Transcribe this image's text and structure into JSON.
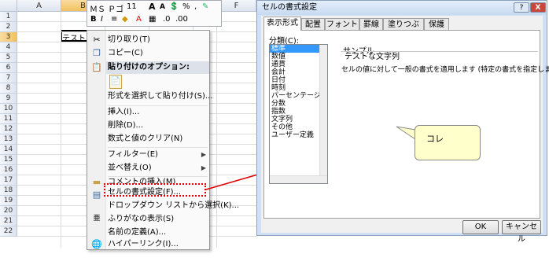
{
  "sheet": {
    "columns": [
      "A",
      "B",
      "C",
      "D",
      "E",
      "F"
    ],
    "rows": [
      "1",
      "2",
      "3",
      "4",
      "5",
      "6",
      "7",
      "8",
      "9",
      "10",
      "11",
      "12",
      "13",
      "14",
      "15",
      "16",
      "17",
      "18",
      "19",
      "20",
      "21",
      "22"
    ],
    "cell_b3": "テストな文字列"
  },
  "mini_toolbar": {
    "font": "ＭＳ Ｐゴ",
    "size": "11",
    "grow": "A",
    "shrink": "A",
    "currency": "",
    "percent": "%",
    "comma": ",",
    "bold": "B",
    "italic": "I",
    "align": "≡",
    "fill": "A"
  },
  "context_menu": {
    "items": [
      {
        "label": "切り取り(T)",
        "icon": "scissors-icon"
      },
      {
        "label": "コピー(C)",
        "icon": "copy-icon"
      },
      {
        "label": "貼り付けのオプション:",
        "icon": "paste-icon",
        "header": true
      },
      {
        "label": "",
        "icon": "paste-option-icon"
      },
      {
        "label": "形式を選択して貼り付け(S)..."
      },
      {
        "label": "挿入(I)..."
      },
      {
        "label": "削除(D)..."
      },
      {
        "label": "数式と値のクリア(N)"
      },
      {
        "label": "フィルター(E)",
        "submenu": true
      },
      {
        "label": "並べ替え(O)",
        "submenu": true
      },
      {
        "label": "コメントの挿入(M)",
        "icon": "comment-icon"
      },
      {
        "label": "セルの書式設定(F)...",
        "icon": "format-cells-icon"
      },
      {
        "label": "ドロップダウン リストから選択(K)..."
      },
      {
        "label": "ふりがなの表示(S)",
        "icon": "furigana-icon"
      },
      {
        "label": "名前の定義(A)..."
      },
      {
        "label": "ハイパーリンク(I)...",
        "icon": "hyperlink-icon"
      }
    ]
  },
  "dialog": {
    "title": "セルの書式設定",
    "help": "?",
    "close": "X",
    "tabs": [
      "表示形式",
      "配置",
      "フォント",
      "罫線",
      "塗りつぶし",
      "保護"
    ],
    "category_label": "分類(C):",
    "categories": [
      "標準",
      "数値",
      "通貨",
      "会計",
      "日付",
      "時刻",
      "パーセンテージ",
      "分数",
      "指数",
      "文字列",
      "その他",
      "ユーザー定義"
    ],
    "sample_label": "サンプル",
    "sample_value": "テストな文字列",
    "description": "セルの値に対して一般の書式を適用します (特定の書式を指定しません)。",
    "ok": "OK",
    "cancel": "キャンセル"
  },
  "callout": {
    "text": "コレ"
  },
  "colors": {
    "highlight": "#3399ff",
    "annotation_red": "#dd0000",
    "callout_fill": "#ffffcc"
  }
}
